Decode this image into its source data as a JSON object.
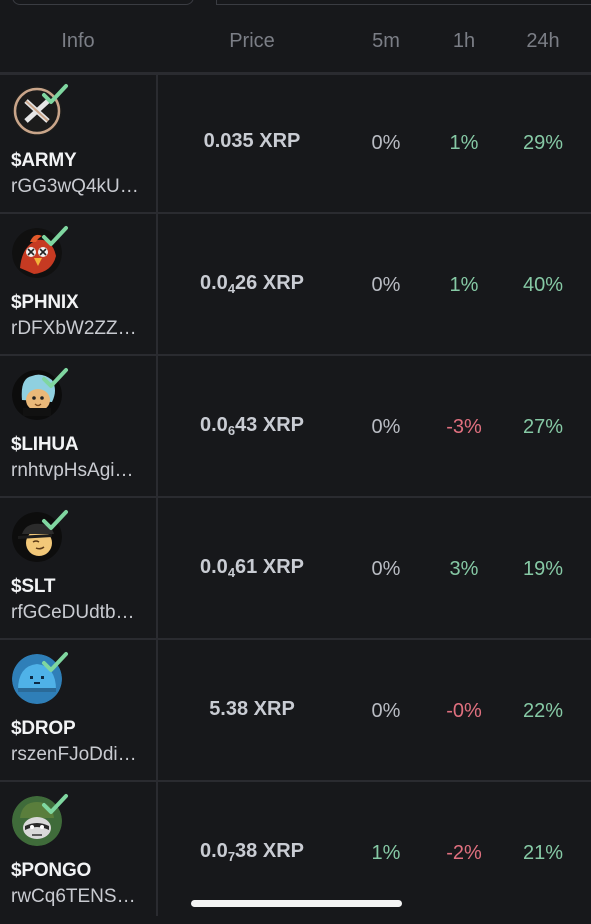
{
  "header": {
    "info": "Info",
    "price": "Price",
    "col_5m": "5m",
    "col_1h": "1h",
    "col_24h": "24h"
  },
  "colors": {
    "background": "#17181b",
    "positive": "#86c9a5",
    "negative": "#e0707f",
    "neutral": "#b9bcc3",
    "verified_check": "#7fd6a0"
  },
  "tokens": [
    {
      "symbol": "$ARMY",
      "address": "rGG3wQ4kU…",
      "price_main": "0.035 XRP",
      "price_prefix": "",
      "price_sub": "",
      "price_rest": "",
      "change_5m": "0%",
      "change_1h": "1%",
      "change_24h": "29%",
      "avatar_icon": "army-x-logo-icon",
      "verified": true
    },
    {
      "symbol": "$PHNIX",
      "address": "rDFXbW2ZZ…",
      "price_main": "",
      "price_prefix": "0.0",
      "price_sub": "4",
      "price_rest": "26 XRP",
      "change_5m": "0%",
      "change_1h": "1%",
      "change_24h": "40%",
      "avatar_icon": "phoenix-bird-icon",
      "verified": true
    },
    {
      "symbol": "$LIHUA",
      "address": "rnhtvpHsAgi…",
      "price_main": "",
      "price_prefix": "0.0",
      "price_sub": "6",
      "price_rest": "43 XRP",
      "change_5m": "0%",
      "change_1h": "-3%",
      "change_24h": "27%",
      "avatar_icon": "lihua-cat-icon",
      "verified": true
    },
    {
      "symbol": "$SLT",
      "address": "rfGCeDUdtb…",
      "price_main": "",
      "price_prefix": "0.0",
      "price_sub": "4",
      "price_rest": "61 XRP",
      "change_5m": "0%",
      "change_1h": "3%",
      "change_24h": "19%",
      "avatar_icon": "cap-face-icon",
      "verified": true
    },
    {
      "symbol": "$DROP",
      "address": "rszenFJoDdi…",
      "price_main": "5.38 XRP",
      "price_prefix": "",
      "price_sub": "",
      "price_rest": "",
      "change_5m": "0%",
      "change_1h": "-0%",
      "change_24h": "22%",
      "avatar_icon": "blue-blob-icon",
      "verified": true
    },
    {
      "symbol": "$PONGO",
      "address": "rwCq6TENS…",
      "price_main": "",
      "price_prefix": "0.0",
      "price_sub": "7",
      "price_rest": "38 XRP",
      "change_5m": "1%",
      "change_1h": "-2%",
      "change_24h": "21%",
      "avatar_icon": "raccoon-helmet-icon",
      "verified": true
    }
  ]
}
